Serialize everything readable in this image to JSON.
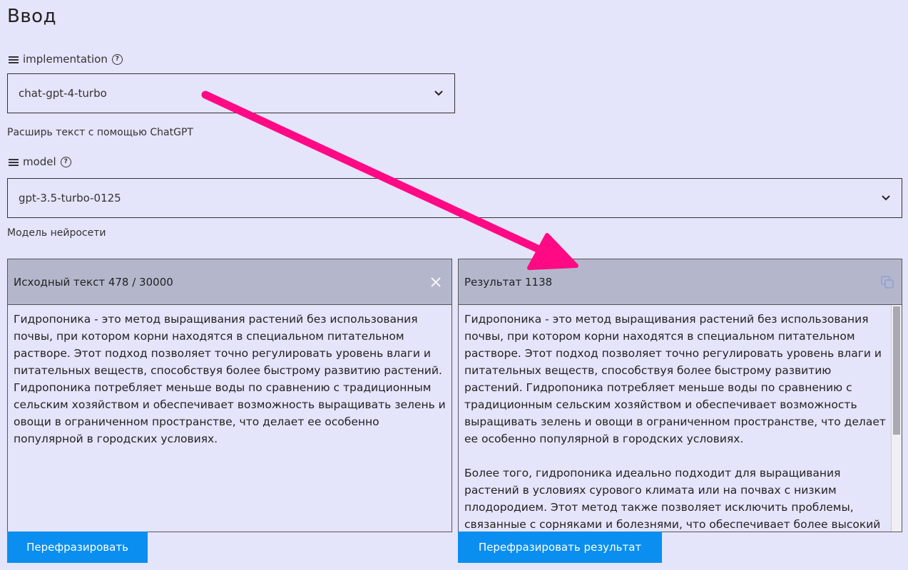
{
  "page": {
    "title": "Ввод"
  },
  "implementation": {
    "label": "implementation",
    "value": "chat-gpt-4-turbo",
    "hint": "Расширь текст с помощью ChatGPT"
  },
  "model": {
    "label": "model",
    "value": "gpt-3.5-turbo-0125",
    "hint": "Модель нейросети"
  },
  "source": {
    "header": "Исходный текст 478 / 30000",
    "text": "Гидропоника - это метод выращивания растений без использования почвы, при котором корни находятся в специальном питательном растворе. Этот подход позволяет точно регулировать уровень влаги и питательных веществ, способствуя более быстрому развитию растений. Гидропоника потребляет меньше воды по сравнению с традиционным сельским хозяйством и обеспечивает возможность выращивать зелень и овощи в ограниченном пространстве, что делает ее особенно популярной в городских условиях.",
    "button": "Перефразировать"
  },
  "result": {
    "header": "Результат 1138",
    "text": "Гидропоника - это метод выращивания растений без использования почвы, при котором корни находятся в специальном питательном растворе. Этот подход позволяет точно регулировать уровень влаги и питательных веществ, способствуя более быстрому развитию растений. Гидропоника потребляет меньше воды по сравнению с традиционным сельским хозяйством и обеспечивает возможность выращивать зелень и овощи в ограниченном пространстве, что делает ее особенно популярной в городских условиях.\n\nБолее того, гидропоника идеально подходит для выращивания растений в условиях сурового климата или на почвах с низким плодородием. Этот метод также позволяет исключить проблемы, связанные с сорняками и болезнями, что обеспечивает более высокий",
    "button": "Перефразировать результат"
  },
  "colors": {
    "accent": "#0a8ef0",
    "arrow": "#ff0a84",
    "header_bg": "#b4b7cc",
    "page_bg": "#e4e4fa"
  },
  "icons": [
    "list-icon",
    "help-icon",
    "chevron-down-icon",
    "close-icon",
    "copy-icon"
  ]
}
